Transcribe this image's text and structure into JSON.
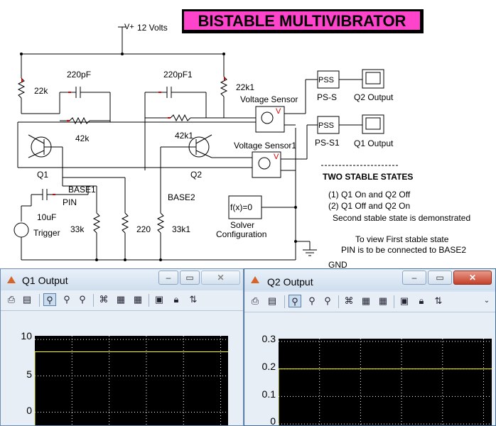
{
  "diagram": {
    "title": "BISTABLE MULTIVIBRATOR",
    "supply_label": "V+",
    "supply_value": "12 Volts",
    "c1": "220pF",
    "c2": "220pF1",
    "r_left": "22k",
    "r_right": "22k1",
    "r_mid1": "42k",
    "r_mid2": "42k1",
    "q1": "Q1",
    "q2": "Q2",
    "base1": "BASE1",
    "base2": "BASE2",
    "pin": "PIN",
    "cap_trigger": "10uF",
    "trigger": "Trigger",
    "r_33k": "33k",
    "r_220": "220",
    "r_33k1": "33k1",
    "vsensor1": "Voltage Sensor",
    "vsensor2": "Voltage Sensor1",
    "vsensor_v": "V",
    "pss_label": "PSS",
    "ps_s": "PS-S",
    "ps_s1": "PS-S1",
    "q2_output_block": "Q2 Output",
    "q1_output_block": "Q1 Output",
    "solver_fx": "f(x)=0",
    "solver_line1": "Solver",
    "solver_line2": "Configuration",
    "gnd": "GND",
    "states_title": "TWO STABLE STATES",
    "state1": "(1) Q1 On and Q2 Off",
    "state2": "(2) Q1 Off and Q2 On",
    "state_demo": "Second stable state is demonstrated",
    "view_line1": "To view First stable state",
    "view_line2": "PIN is to be connected to BASE2"
  },
  "windows": [
    {
      "title": "Q1 Output",
      "active": false,
      "y_ticks": [
        "10",
        "5",
        "0"
      ],
      "signal_level": 8.3,
      "ylim": [
        -2,
        10.5
      ]
    },
    {
      "title": "Q2 Output",
      "active": true,
      "y_ticks": [
        "0.3",
        "0.2",
        "0.1",
        "0"
      ],
      "signal_level": 0.2,
      "ylim": [
        -0.01,
        0.31
      ]
    }
  ],
  "toolbar_icons": [
    "print-icon",
    "print-setup-icon",
    "zoom-icon",
    "zoom-x-icon",
    "zoom-y-icon",
    "binoculars-icon",
    "save-axes-icon",
    "restore-axes-icon",
    "params-icon",
    "lock-icon",
    "float-icon"
  ],
  "colors": {
    "title_bg": "#ff44cc",
    "plot_bg": "#000000",
    "signal": "#ffff00",
    "grid": "#ffffff"
  }
}
